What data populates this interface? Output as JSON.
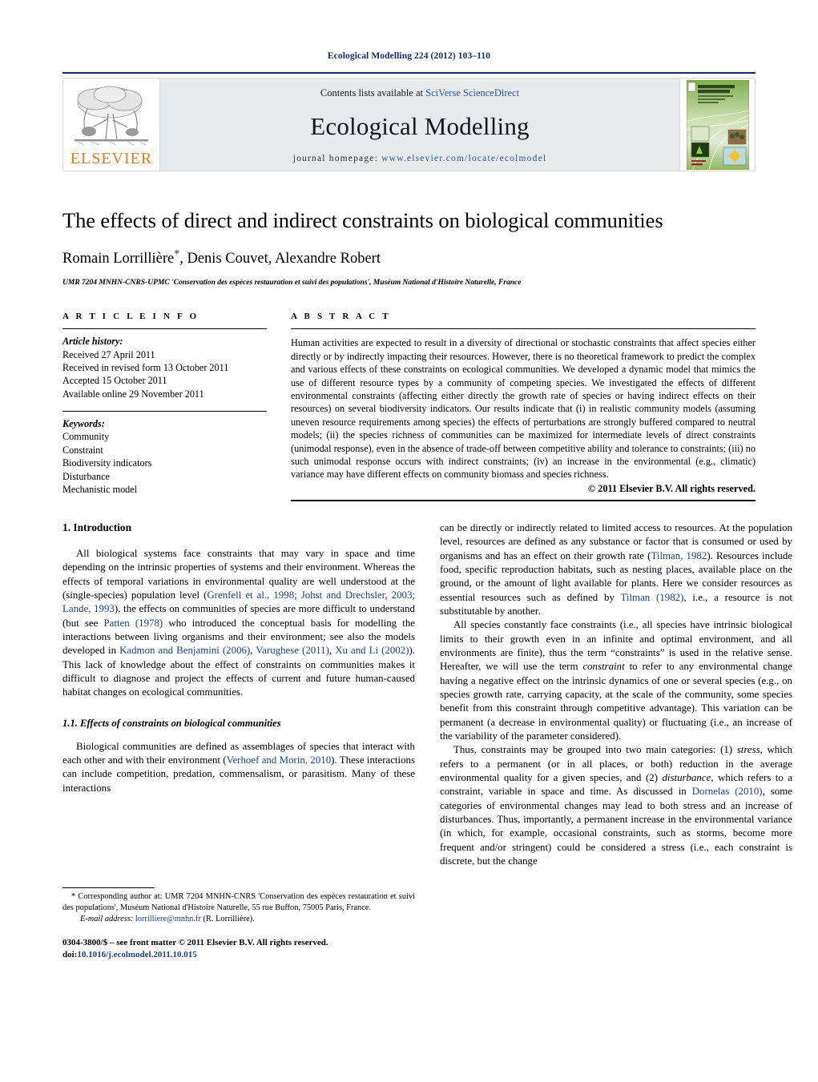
{
  "running_head": "Ecological Modelling 224 (2012) 103–110",
  "masthead": {
    "contents_prefix": "Contents lists available at ",
    "contents_link": "SciVerse ScienceDirect",
    "journal_title": "Ecological Modelling",
    "homepage_prefix": "journal homepage: ",
    "homepage_url": "www.elsevier.com/locate/ecolmodel",
    "publisher_wordmark": "ELSEVIER",
    "cover_title_line1": "ECOLOGICAL",
    "cover_title_line2": "MODELLING"
  },
  "article": {
    "title": "The effects of direct and indirect constraints on biological communities",
    "authors": "Romain Lorrillière",
    "authors_rest": ", Denis Couvet, Alexandre Robert",
    "corresponding_marker": "*",
    "affiliation": "UMR 7204 MNHN-CNRS-UPMC 'Conservation des espèces restauration et suivi des populations', Muséum National d'Histoire Naturelle, France"
  },
  "info": {
    "heading": "A R T I C L E   I N F O",
    "history_label": "Article history:",
    "history": [
      "Received 27 April 2011",
      "Received in revised form 13 October 2011",
      "Accepted 15 October 2011",
      "Available online 29 November 2011"
    ],
    "keywords_label": "Keywords:",
    "keywords": [
      "Community",
      "Constraint",
      "Biodiversity indicators",
      "Disturbance",
      "Mechanistic model"
    ]
  },
  "abstract": {
    "heading": "A B S T R A C T",
    "text": "Human activities are expected to result in a diversity of directional or stochastic constraints that affect species either directly or by indirectly impacting their resources. However, there is no theoretical framework to predict the complex and various effects of these constraints on ecological communities. We developed a dynamic model that mimics the use of different resource types by a community of competing species. We investigated the effects of different environmental constraints (affecting either directly the growth rate of species or having indirect effects on their resources) on several biodiversity indicators. Our results indicate that (i) in realistic community models (assuming uneven resource requirements among species) the effects of perturbations are strongly buffered compared to neutral models; (ii) the species richness of communities can be maximized for intermediate levels of direct constraints (unimodal response), even in the absence of trade-off between competitive ability and tolerance to constraints; (iii) no such unimodal response occurs with indirect constraints; (iv) an increase in the environmental (e.g., climatic) variance may have different effects on community biomass and species richness.",
    "copyright": "© 2011 Elsevier B.V. All rights reserved."
  },
  "body": {
    "section1_heading": "1.  Introduction",
    "p1_a": "All biological systems face constraints that may vary in space and time depending on the intrinsic properties of systems and their environment. Whereas the effects of temporal variations in environmental quality are well understood at the (single-species) population level (",
    "p1_ref1": "Grenfell et al., 1998; Johst and Drechsler, 2003; Lande, 1993",
    "p1_b": "), the effects on communities of species are more difficult to understand (but see ",
    "p1_ref2": "Patten (1978)",
    "p1_c": " who introduced the conceptual basis for modelling the interactions between living organisms and their environment; see also the models developed in ",
    "p1_ref3": "Kadmon and Benjamini (2006)",
    "p1_d": ", ",
    "p1_ref4": "Varughese (2011)",
    "p1_e": ", ",
    "p1_ref5": "Xu and Li (2002)",
    "p1_f": "). This lack of knowledge about the effect of constraints on communities makes it difficult to diagnose and project the effects of current and future human-caused habitat changes on ecological communities.",
    "section11_heading": "1.1.  Effects of constraints on biological communities",
    "p2_a": "Biological communities are defined as assemblages of species that interact with each other and with their environment (",
    "p2_ref1": "Verhoef and Morin, 2010",
    "p2_b": "). These interactions can include competition, predation, commensalism, or parasitism. Many of these interactions",
    "p3_a": "can be directly or indirectly related to limited access to resources. At the population level, resources are defined as any substance or factor that is consumed or used by organisms and has an effect on their growth rate (",
    "p3_ref1": "Tilman, 1982",
    "p3_b": "). Resources include food, specific reproduction habitats, such as nesting places, available place on the ground, or the amount of light available for plants. Here we consider resources as essential resources such as defined by ",
    "p3_ref2": "Tilman (1982)",
    "p3_c": ", i.e., a resource is not substitutable by another.",
    "p4_a": "All species constantly face constraints (i.e., all species have intrinsic biological limits to their growth even in an infinite and optimal environment, and all environments are finite), thus the term “constraints” is used in the relative sense. Hereafter, we will use the term ",
    "p4_italic1": "constraint",
    "p4_b": " to refer to any environmental change having a negative effect on the intrinsic dynamics of one or several species (e.g., on species growth rate, carrying capacity, at the scale of the community, some species benefit from this constraint through competitive advantage). This variation can be permanent (a decrease in environmental quality) or fluctuating (i.e., an increase of the variability of the parameter considered).",
    "p5_a": "Thus, constraints may be grouped into two main categories: (1) ",
    "p5_italic1": "stress",
    "p5_b": ", which refers to a permanent (or in all places, or both) reduction in the average environmental quality for a given species, and (2) ",
    "p5_italic2": "disturbance",
    "p5_c": ", which refers to a constraint, variable in space and time. As discussed in ",
    "p5_ref1": "Dornelas (2010)",
    "p5_d": ", some categories of environmental changes may lead to both stress and an increase of disturbances. Thus, importantly, a permanent increase in the environmental variance (in which, for example, occasional constraints, such as storms, become more frequent and/or stringent) could be considered a stress (i.e., each constraint is discrete, but the change"
  },
  "footnotes": {
    "corresponding_star": "*",
    "corresponding_text": " Corresponding author at: UMR 7204 MNHN-CNRS 'Conservation des espèces restauration et suivi des populations', Muséum National d'Histoire Naturelle, 55 rue Buffon, 75005 Paris, France.",
    "email_label": "E-mail address:",
    "email_address": "lorrilliere@mnhn.fr",
    "email_suffix": " (R. Lorrillière).",
    "issn_line": "0304-3800/$ – see front matter © 2011 Elsevier B.V. All rights reserved.",
    "doi_label": "doi:",
    "doi_value": "10.1016/j.ecolmodel.2011.10.015"
  },
  "colors": {
    "header_blue": "#1b2a6b",
    "link_blue": "#2b57a8",
    "ref_blue": "#1b3f8f",
    "elsevier_orange": "#e87722",
    "masthead_gray": "#e7e9eb"
  }
}
